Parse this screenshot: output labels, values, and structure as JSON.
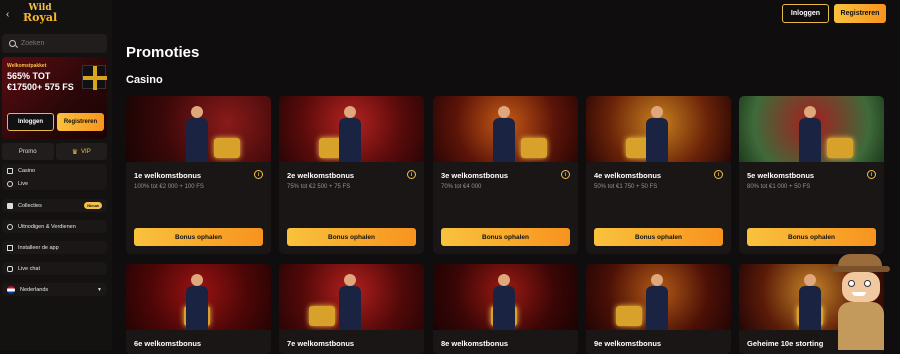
{
  "topbar": {
    "back": "‹",
    "logo_line1": "Wild",
    "logo_line2": "Royal",
    "login": "Inloggen",
    "register": "Registreren"
  },
  "sidebar": {
    "search_placeholder": "Zoeken",
    "promo": {
      "kicker": "Welkomstpakket",
      "line1": "565% TOT",
      "line2": "€17500+ 575 FS",
      "login": "Inloggen",
      "register": "Registreren"
    },
    "tabs": {
      "promo": "Promo",
      "vip": "VIP"
    },
    "nav1": [
      "Casino",
      "Live"
    ],
    "collections": "Collecties",
    "collections_badge": "Nieuw",
    "invite": "Uitnodigen & Verdienen",
    "install": "Installeer de app",
    "chat": "Live chat",
    "language": "Nederlands"
  },
  "main": {
    "title": "Promoties",
    "section": "Casino",
    "cta": "Bonus ophalen",
    "cards_row1": [
      {
        "title": "1e welkomstbonus",
        "desc": "100% tot €2 000 + 100 FS"
      },
      {
        "title": "2e welkomstbonus",
        "desc": "75% tot €2 500 + 75 FS"
      },
      {
        "title": "3e welkomstbonus",
        "desc": "70% tot €4 000"
      },
      {
        "title": "4e welkomstbonus",
        "desc": "50% tot €1 750 + 50 FS"
      },
      {
        "title": "5e welkomstbonus",
        "desc": "80% tot €1 000 + 50 FS"
      }
    ],
    "cards_row2": [
      {
        "title": "6e welkomstbonus"
      },
      {
        "title": "7e welkomstbonus"
      },
      {
        "title": "8e welkomstbonus"
      },
      {
        "title": "9e welkomstbonus"
      },
      {
        "title": "Geheime 10e storting"
      }
    ]
  },
  "colors": {
    "accent": "#f9c23c",
    "accent2": "#f7931e",
    "background": "#0f0d0d",
    "card": "#1b1616"
  }
}
